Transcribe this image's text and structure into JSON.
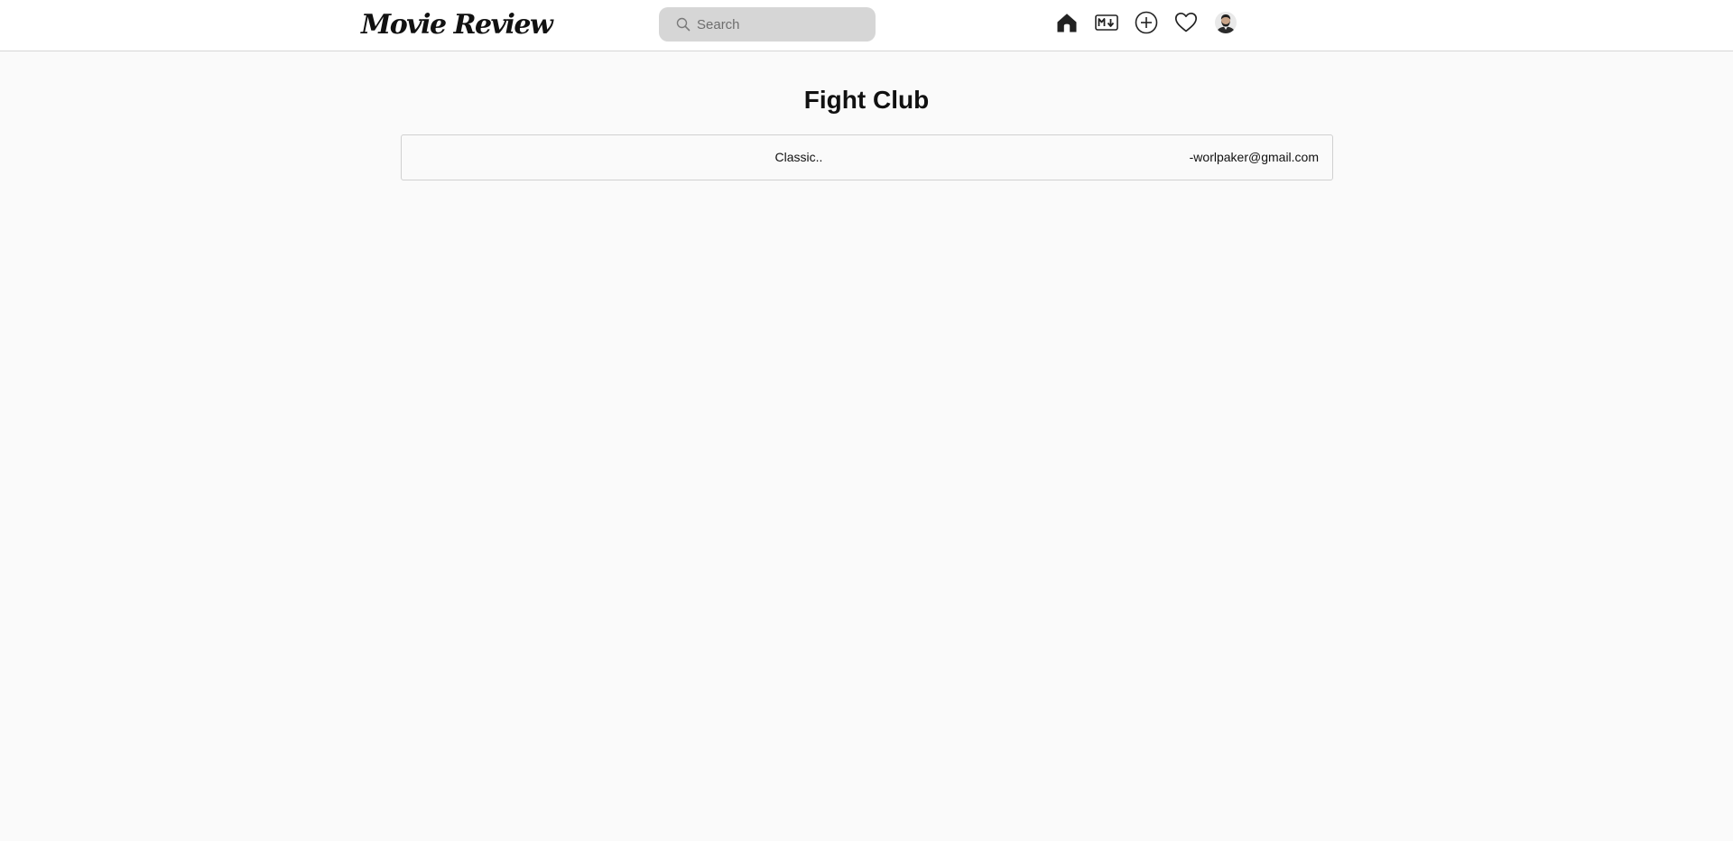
{
  "header": {
    "logo_text": "Movie Review",
    "search": {
      "placeholder": "Search",
      "value": ""
    },
    "nav": [
      {
        "icon": "home-icon",
        "label": "Home"
      },
      {
        "icon": "markdown-icon",
        "label": "Markdown"
      },
      {
        "icon": "add-circle-icon",
        "label": "Add"
      },
      {
        "icon": "heart-icon",
        "label": "Favorites"
      },
      {
        "icon": "avatar",
        "label": "Profile"
      }
    ]
  },
  "main": {
    "title": "Fight Club",
    "reviews": [
      {
        "text": "Classic..",
        "author": "-worlpaker@gmail.com"
      }
    ]
  },
  "colors": {
    "background": "#fafafa",
    "header_background": "#ffffff",
    "search_background": "#d6d6d6",
    "border": "#d0d0d0",
    "text": "#111111"
  }
}
